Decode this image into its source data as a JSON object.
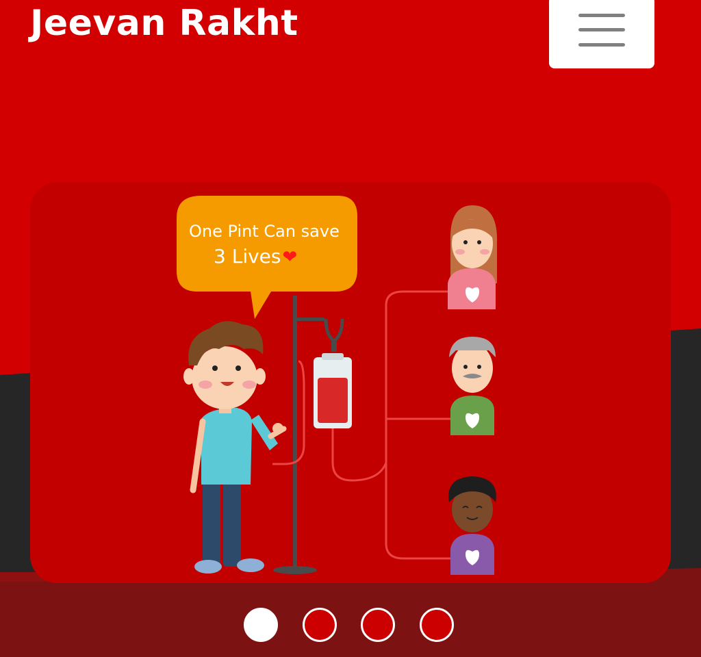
{
  "header": {
    "brand": "Jeevan Rakht",
    "menu_icon": "hamburger-menu-icon"
  },
  "slide": {
    "speech_line1": "One Pint Can save",
    "speech_line2": "3 Lives",
    "heart_glyph": "❤"
  },
  "carousel": {
    "slide_count": 4,
    "active_index": 0
  },
  "colors": {
    "brand_red": "#d20000",
    "card_red": "#c30000",
    "dark_band": "#262626",
    "bubble_orange": "#f59b00"
  }
}
